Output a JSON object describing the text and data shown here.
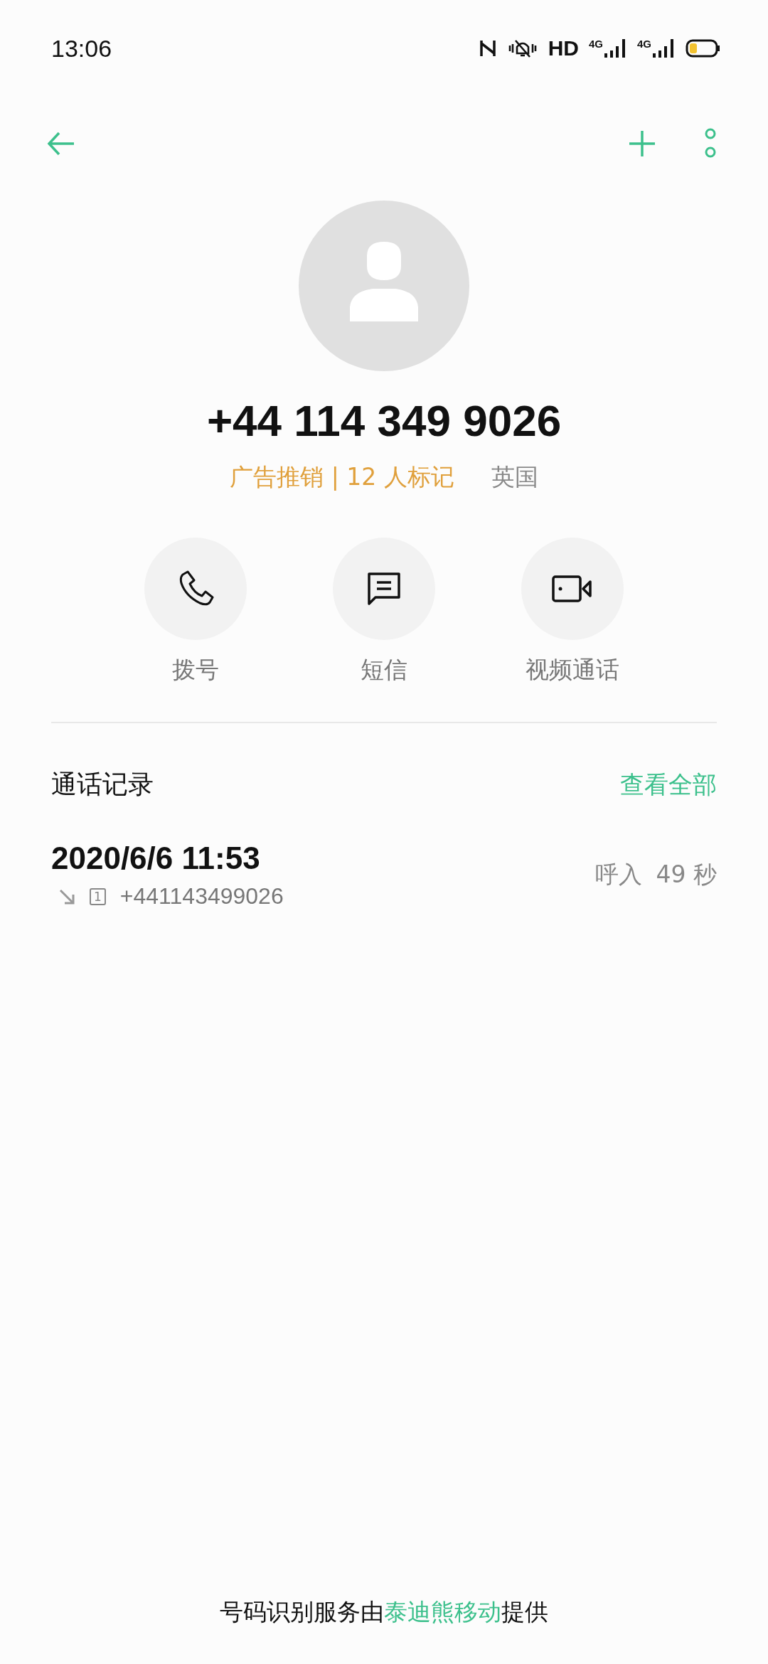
{
  "status_bar": {
    "time": "13:06",
    "hd": "HD",
    "networks": [
      "4G",
      "4G"
    ]
  },
  "contact": {
    "number": "+44 114 349 9026",
    "tag": "广告推销 | 12 人标记",
    "region": "英国"
  },
  "actions": [
    {
      "kind": "call",
      "label": "拨号"
    },
    {
      "kind": "message",
      "label": "短信"
    },
    {
      "kind": "video",
      "label": "视频通话"
    }
  ],
  "call_log": {
    "title": "通话记录",
    "view_all": "查看全部",
    "entries": [
      {
        "datetime": "2020/6/6 11:53",
        "sim": "1",
        "number": "+441143499026",
        "type": "呼入",
        "duration": "49 秒"
      }
    ]
  },
  "footer": {
    "before": "号码识别服务由",
    "provider": "泰迪熊移动",
    "after": "提供"
  }
}
